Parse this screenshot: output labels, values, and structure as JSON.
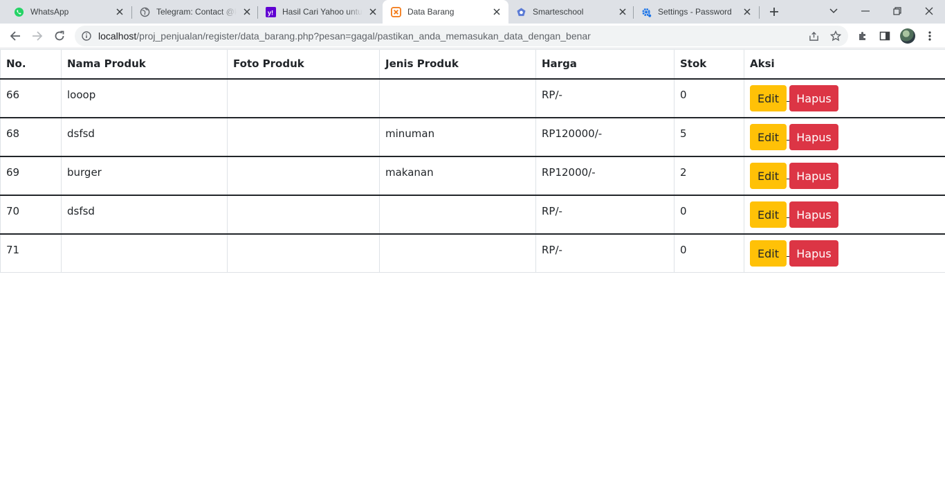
{
  "browser": {
    "tabs": [
      {
        "title": "WhatsApp",
        "icon": "whatsapp-icon",
        "active": false
      },
      {
        "title": "Telegram: Contact @k",
        "icon": "globe-icon",
        "active": false
      },
      {
        "title": "Hasil Cari Yahoo untuk",
        "icon": "yahoo-icon",
        "active": false
      },
      {
        "title": "Data Barang",
        "icon": "xampp-icon",
        "active": true
      },
      {
        "title": "Smarteschool",
        "icon": "smarteschool-icon",
        "active": false
      },
      {
        "title": "Settings - Passwords",
        "icon": "settings-gear-icon",
        "active": false
      }
    ],
    "url_host": "localhost",
    "url_path": "/proj_penjualan/register/data_barang.php?pesan=gagal/pastikan_anda_memasukan_data_dengan_benar"
  },
  "table": {
    "headers": [
      "No.",
      "Nama Produk",
      "Foto Produk",
      "Jenis Produk",
      "Harga",
      "Stok",
      "Aksi"
    ],
    "rows": [
      {
        "no": "66",
        "nama": "looop",
        "foto": "",
        "jenis": "",
        "harga": "RP/-",
        "stok": "0"
      },
      {
        "no": "68",
        "nama": "dsfsd",
        "foto": "",
        "jenis": "minuman",
        "harga": "RP120000/-",
        "stok": "5"
      },
      {
        "no": "69",
        "nama": "burger",
        "foto": "",
        "jenis": "makanan",
        "harga": "RP12000/-",
        "stok": "2"
      },
      {
        "no": "70",
        "nama": "dsfsd",
        "foto": "",
        "jenis": "",
        "harga": "RP/-",
        "stok": "0"
      },
      {
        "no": "71",
        "nama": "",
        "foto": "",
        "jenis": "",
        "harga": "RP/-",
        "stok": "0"
      }
    ],
    "edit_label": "Edit",
    "hapus_label": "Hapus"
  },
  "colors": {
    "edit_button": "#ffc107",
    "hapus_button": "#dc3545",
    "tabstrip": "#dee1e6"
  }
}
